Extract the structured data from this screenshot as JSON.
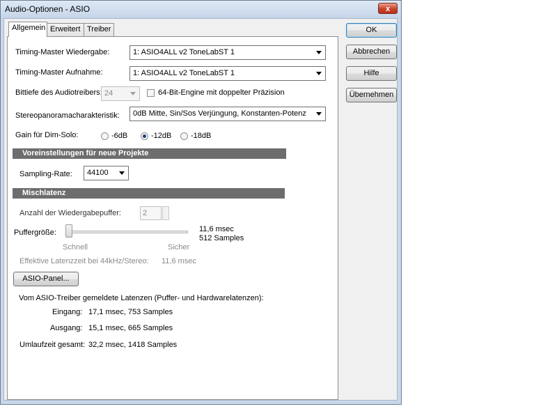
{
  "window": {
    "title": "Audio-Optionen - ASIO",
    "close_glyph": "x"
  },
  "tabs": [
    "Allgemein",
    "Erweitert",
    "Treiber"
  ],
  "buttons": {
    "ok": "OK",
    "cancel": "Abbrechen",
    "help": "Hilfe",
    "apply": "Übernehmen"
  },
  "general": {
    "timing_playback_label": "Timing-Master Wiedergabe:",
    "timing_playback_value": "1: ASIO4ALL v2 ToneLabST 1",
    "timing_record_label": "Timing-Master Aufnahme:",
    "timing_record_value": "1: ASIO4ALL v2 ToneLabST 1",
    "bitdepth_label": "Bittiefe des Audiotreibers:",
    "bitdepth_value": "24",
    "engine64_label": "64-Bit-Engine mit doppelter Präzision",
    "stereo_label": "Stereopanoramacharakteristik:",
    "stereo_value": "0dB Mitte, Sin/Sos Verjüngung, Konstanten-Potenz",
    "dimsolo_label": "Gain für Dim-Solo:",
    "dimsolo_options": [
      "-6dB",
      "-12dB",
      "-18dB"
    ],
    "dimsolo_selected": "-12dB"
  },
  "project_defaults": {
    "heading": "Voreinstellungen für neue Projekte",
    "sampling_label": "Sampling-Rate:",
    "sampling_value": "44100"
  },
  "mix_latency": {
    "heading": "Mischlatenz",
    "buffers_label": "Anzahl der Wiedergabepuffer:",
    "buffers_value": "2",
    "buffersize_label": "Puffergröße:",
    "buffersize_msec": "11,6 msec",
    "buffersize_samples": "512 Samples",
    "slider_min_label": "Schnell",
    "slider_max_label": "Sicher",
    "slider_position": 0,
    "effective_label": "Effektive Latenzzeit bei 44kHz/Stereo:",
    "effective_value": "11,6 msec",
    "asio_panel_button": "ASIO-Panel...",
    "reported_heading": "Vom ASIO-Treiber gemeldete Latenzen (Puffer- und Hardwarelatenzen):",
    "input_label": "Eingang:",
    "input_value": "17,1 msec, 753 Samples",
    "output_label": "Ausgang:",
    "output_value": "15,1 msec, 665 Samples",
    "roundtrip_label": "Umlaufzeit gesamt:",
    "roundtrip_value": "32,2 msec, 1418 Samples"
  }
}
